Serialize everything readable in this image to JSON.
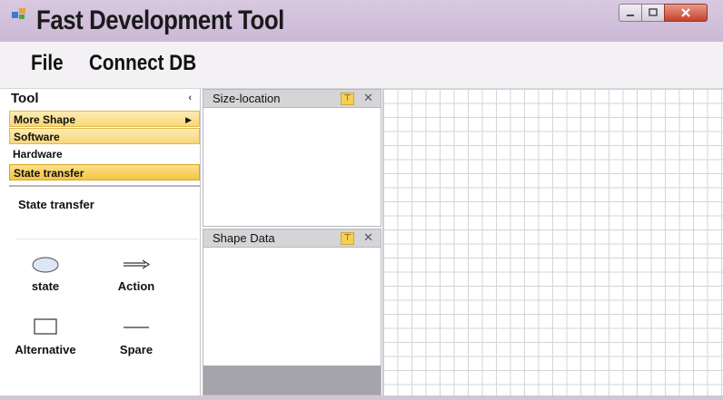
{
  "window": {
    "title": "Fast Development Tool",
    "icon": "app-icon",
    "controls": [
      "minimize-icon",
      "maximize-icon",
      "close-icon"
    ]
  },
  "menu": {
    "items": [
      "File",
      "Connect DB"
    ]
  },
  "tool_panel": {
    "header": "Tool",
    "collapse_glyph": "‹",
    "categories": [
      {
        "label": "More Shape",
        "has_submenu": true,
        "highlighted": true
      },
      {
        "label": "Software",
        "highlighted": true
      },
      {
        "label": "Hardware",
        "highlighted": false
      },
      {
        "label": "State transfer",
        "selected": true
      }
    ],
    "section_title": "State transfer",
    "shapes": [
      {
        "label": "state",
        "icon": "ellipse-icon"
      },
      {
        "label": "Action",
        "icon": "arrow-icon"
      },
      {
        "label": "Alternative",
        "icon": "rectangle-icon"
      },
      {
        "label": "Spare",
        "icon": "line-icon"
      }
    ]
  },
  "panels": {
    "size_location": {
      "title": "Size-location"
    },
    "shape_data": {
      "title": "Shape Data"
    },
    "pin_glyph": "⊤",
    "close_glyph": "✕"
  },
  "colors": {
    "titlebar": "#cbb8d6",
    "highlight": "#f7d778",
    "selected": "#f5c542",
    "grid_line": "#d3d5da"
  }
}
